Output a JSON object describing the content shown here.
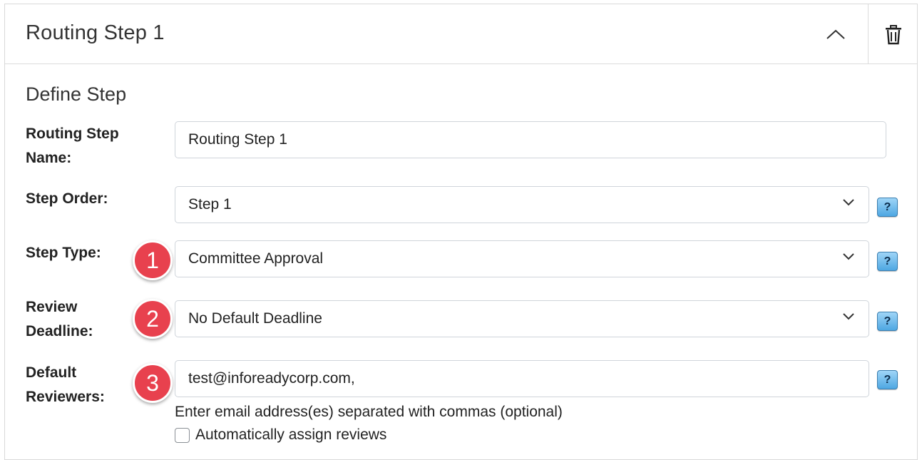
{
  "panel": {
    "title": "Routing Step 1",
    "collapse_icon": "chevron-up-icon",
    "delete_icon": "trash-icon"
  },
  "section": {
    "title": "Define Step"
  },
  "fields": {
    "name": {
      "label_line1": "Routing Step",
      "label_line2": "Name:",
      "value": "Routing Step 1"
    },
    "order": {
      "label": "Step Order:",
      "value": "Step 1"
    },
    "type": {
      "label": "Step Type:",
      "value": "Committee Approval",
      "badge": "1"
    },
    "deadline": {
      "label_line1": "Review",
      "label_line2": "Deadline:",
      "value": "No Default Deadline",
      "badge": "2"
    },
    "reviewers": {
      "label_line1": "Default",
      "label_line2": "Reviewers:",
      "value": "test@inforeadycorp.com,",
      "badge": "3",
      "hint": "Enter email address(es) separated with commas (optional)",
      "auto_assign_label": "Automatically assign reviews",
      "auto_assign_checked": false
    }
  },
  "help_label": "?",
  "colors": {
    "badge": "#e8414e",
    "help_icon": "#4ea7e2",
    "border": "#cfd4da"
  }
}
